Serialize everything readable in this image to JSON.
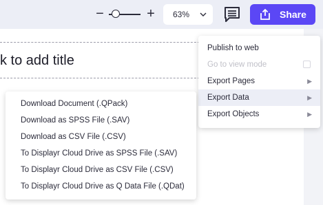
{
  "toolbar": {
    "zoom_minus": "−",
    "zoom_plus": "+",
    "zoom_level": "63%",
    "zoom_slider_value": 0.15,
    "share_label": "Share",
    "share_color": "#5b47f5"
  },
  "page": {
    "title_placeholder": "k to add title"
  },
  "menu": {
    "items": [
      {
        "label": "Publish to web",
        "disabled": false,
        "submenu": false
      },
      {
        "label": "Go to view mode",
        "disabled": true,
        "submenu": false
      },
      {
        "label": "Export Pages",
        "disabled": false,
        "submenu": true
      },
      {
        "label": "Export Data",
        "disabled": false,
        "submenu": true,
        "active": true
      },
      {
        "label": "Export Objects",
        "disabled": false,
        "submenu": true
      }
    ],
    "arrow": "▶"
  },
  "submenu": {
    "items": [
      "Download Document (.QPack)",
      "Download as SPSS File (.SAV)",
      "Download as CSV File (.CSV)",
      "To Displayr Cloud Drive as SPSS File (.SAV)",
      "To Displayr Cloud Drive as CSV File (.CSV)",
      "To Displayr Cloud Drive as Q Data File (.QDat)"
    ]
  }
}
